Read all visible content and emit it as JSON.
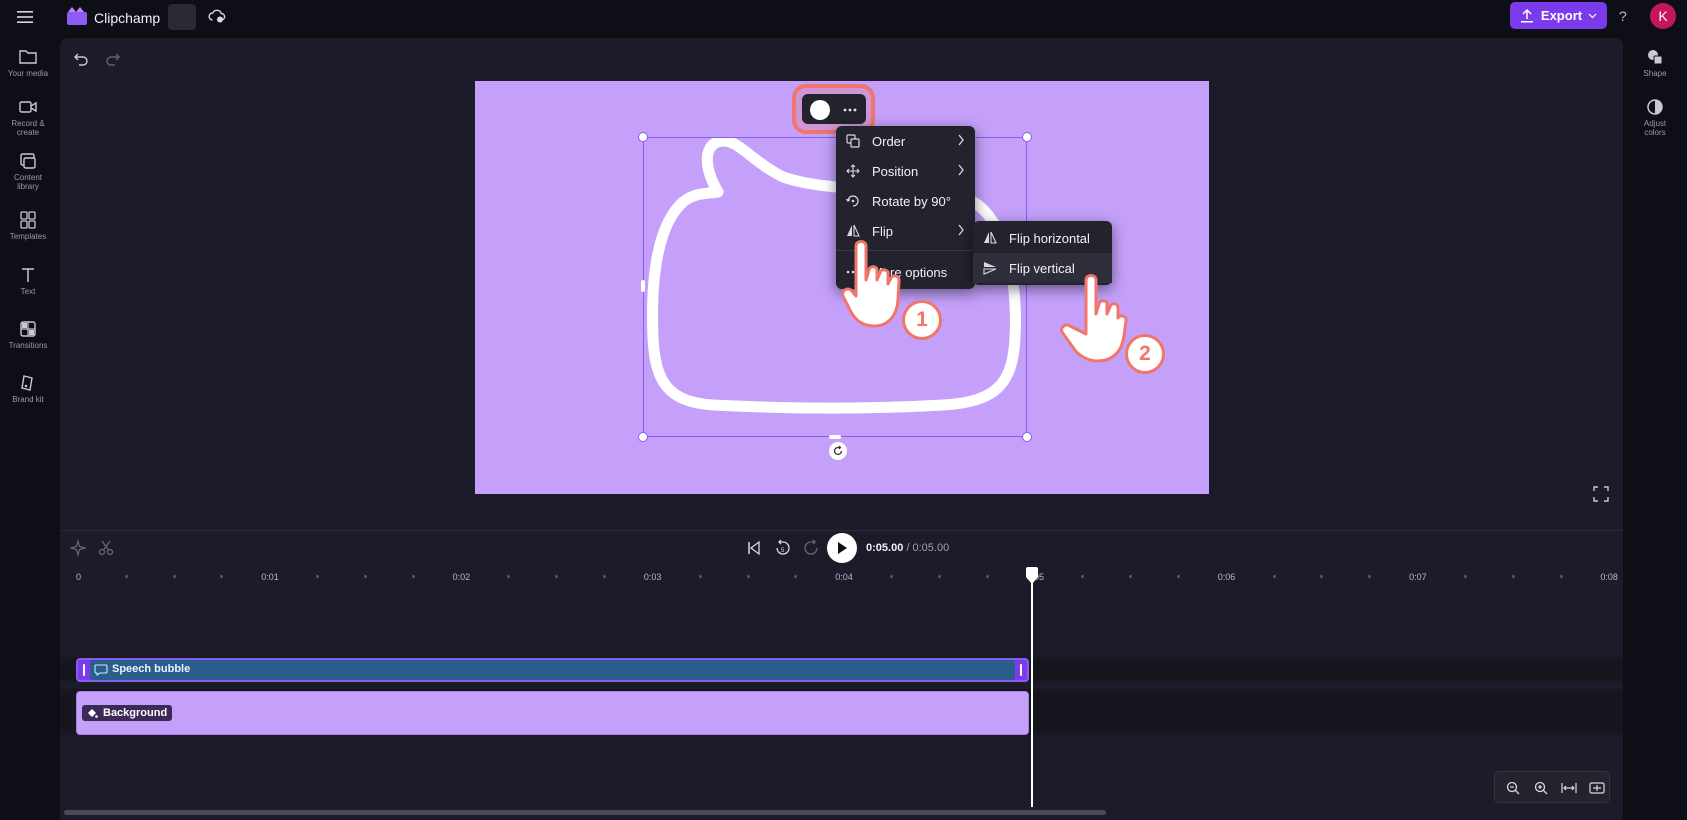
{
  "app": {
    "name": "Clipchamp",
    "avatar_initial": "K"
  },
  "toolbar": {
    "export_label": "Export",
    "help_label": "?"
  },
  "left_rail": [
    {
      "label": "Your media",
      "icon": "folder-icon"
    },
    {
      "label": "Record & create",
      "icon": "camera-icon"
    },
    {
      "label": "Content library",
      "icon": "library-icon"
    },
    {
      "label": "Templates",
      "icon": "templates-icon"
    },
    {
      "label": "Text",
      "icon": "text-icon"
    },
    {
      "label": "Transitions",
      "icon": "transitions-icon"
    },
    {
      "label": "Brand kit",
      "icon": "brand-kit-icon"
    }
  ],
  "right_rail": [
    {
      "label": "Shape",
      "icon": "shape-icon"
    },
    {
      "label": "Adjust colors",
      "icon": "adjust-colors-icon"
    }
  ],
  "context_menu": {
    "items": [
      {
        "label": "Order",
        "icon": "order-icon",
        "has_submenu": true
      },
      {
        "label": "Position",
        "icon": "position-icon",
        "has_submenu": true
      },
      {
        "label": "Rotate by 90°",
        "icon": "rotate-icon",
        "has_submenu": false
      },
      {
        "label": "Flip",
        "icon": "flip-icon",
        "has_submenu": true
      },
      {
        "label": "More options",
        "icon": "more-icon",
        "has_submenu": false
      }
    ]
  },
  "flip_submenu": {
    "items": [
      {
        "label": "Flip horizontal",
        "icon": "flip-horizontal-icon"
      },
      {
        "label": "Flip vertical",
        "icon": "flip-vertical-icon"
      }
    ]
  },
  "annotations": {
    "step1": "1",
    "step2": "2"
  },
  "playback": {
    "current_time": "0:05.00",
    "separator": " / ",
    "total_time": "0:05.00"
  },
  "timeline": {
    "ticks": [
      "0",
      "0:01",
      "0:02",
      "0:03",
      "0:04",
      "0:05",
      "0:06",
      "0:07",
      "0:08"
    ],
    "tracks": [
      {
        "label": "Speech bubble",
        "icon": "shape-clip-icon"
      },
      {
        "label": "Background",
        "icon": "paint-bucket-icon"
      }
    ]
  },
  "colors": {
    "accent": "#7c3aed",
    "canvas_background": "#c4a0fb",
    "speech_clip": "#2a5f8c",
    "background_clip": "#c4a0fb",
    "annotation": "#f0756a"
  }
}
